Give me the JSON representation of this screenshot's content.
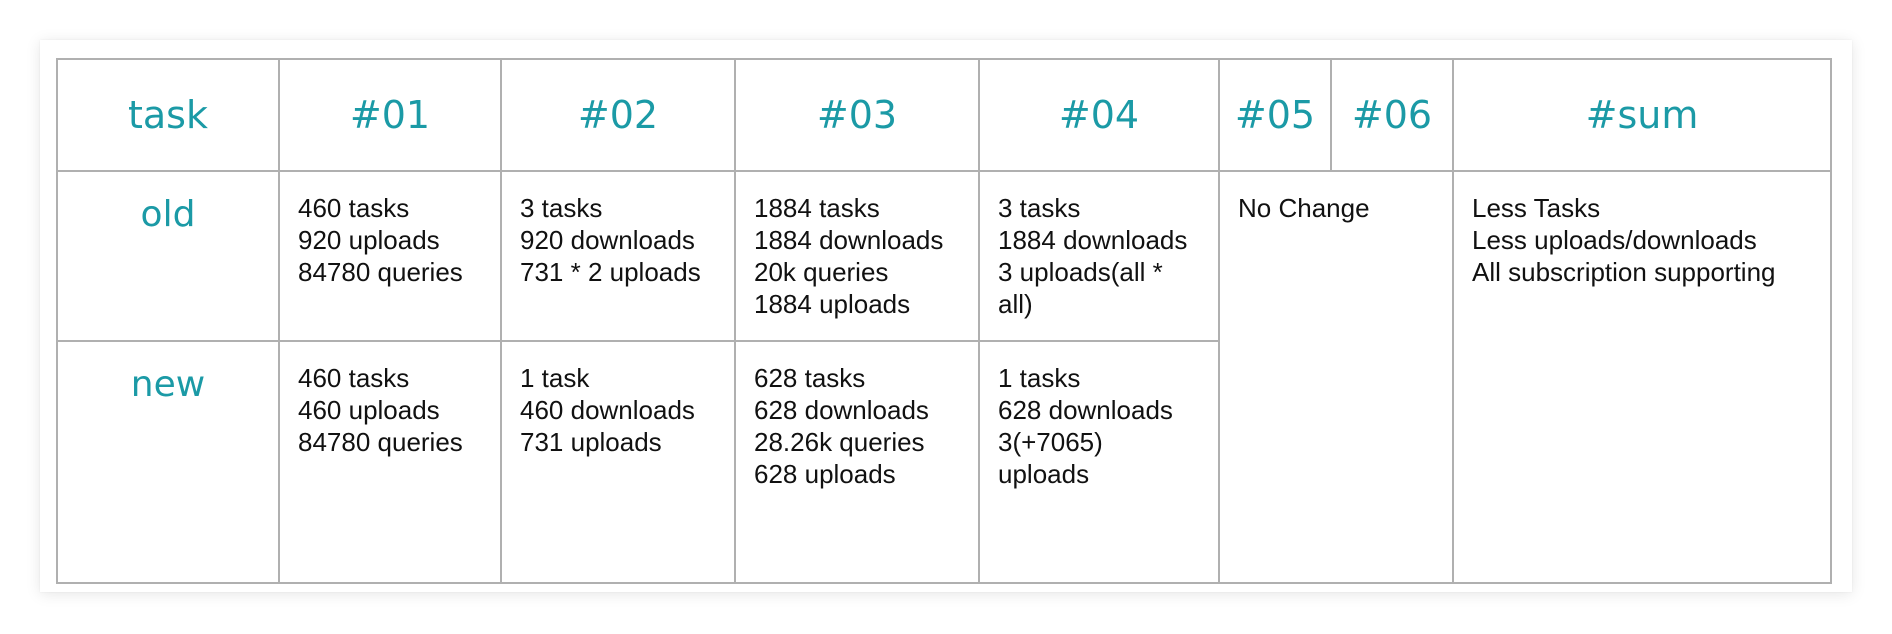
{
  "colors": {
    "header_text": "#1b9aa6",
    "body_text": "#111111",
    "grid_line": "#b0b0b0"
  },
  "table": {
    "headers": {
      "task": "task",
      "c01": "#01",
      "c02": "#02",
      "c03": "#03",
      "c04": "#04",
      "c05": "#05",
      "c06": "#06",
      "sum": "#sum"
    },
    "rows": {
      "old": {
        "label": "old",
        "c01": [
          "460 tasks",
          "920 uploads",
          "84780 queries"
        ],
        "c02": [
          "3 tasks",
          "920 downloads",
          "731 * 2 uploads"
        ],
        "c03": [
          "1884 tasks",
          "1884 downloads",
          "20k queries",
          "1884 uploads"
        ],
        "c04": [
          "3 tasks",
          "1884 downloads",
          "3 uploads(all *",
          "all)"
        ]
      },
      "new": {
        "label": "new",
        "c01": [
          "460 tasks",
          "460 uploads",
          "84780 queries"
        ],
        "c02": [
          "1 task",
          "460 downloads",
          "731 uploads"
        ],
        "c03": [
          "628 tasks",
          "628 downloads",
          "28.26k queries",
          "628 uploads"
        ],
        "c04": [
          "1 tasks",
          "628 downloads",
          "3(+7065)",
          "uploads"
        ]
      }
    },
    "c05_06": "No Change",
    "sum": [
      "Less Tasks",
      "Less uploads/downloads",
      "All subscription supporting"
    ]
  }
}
